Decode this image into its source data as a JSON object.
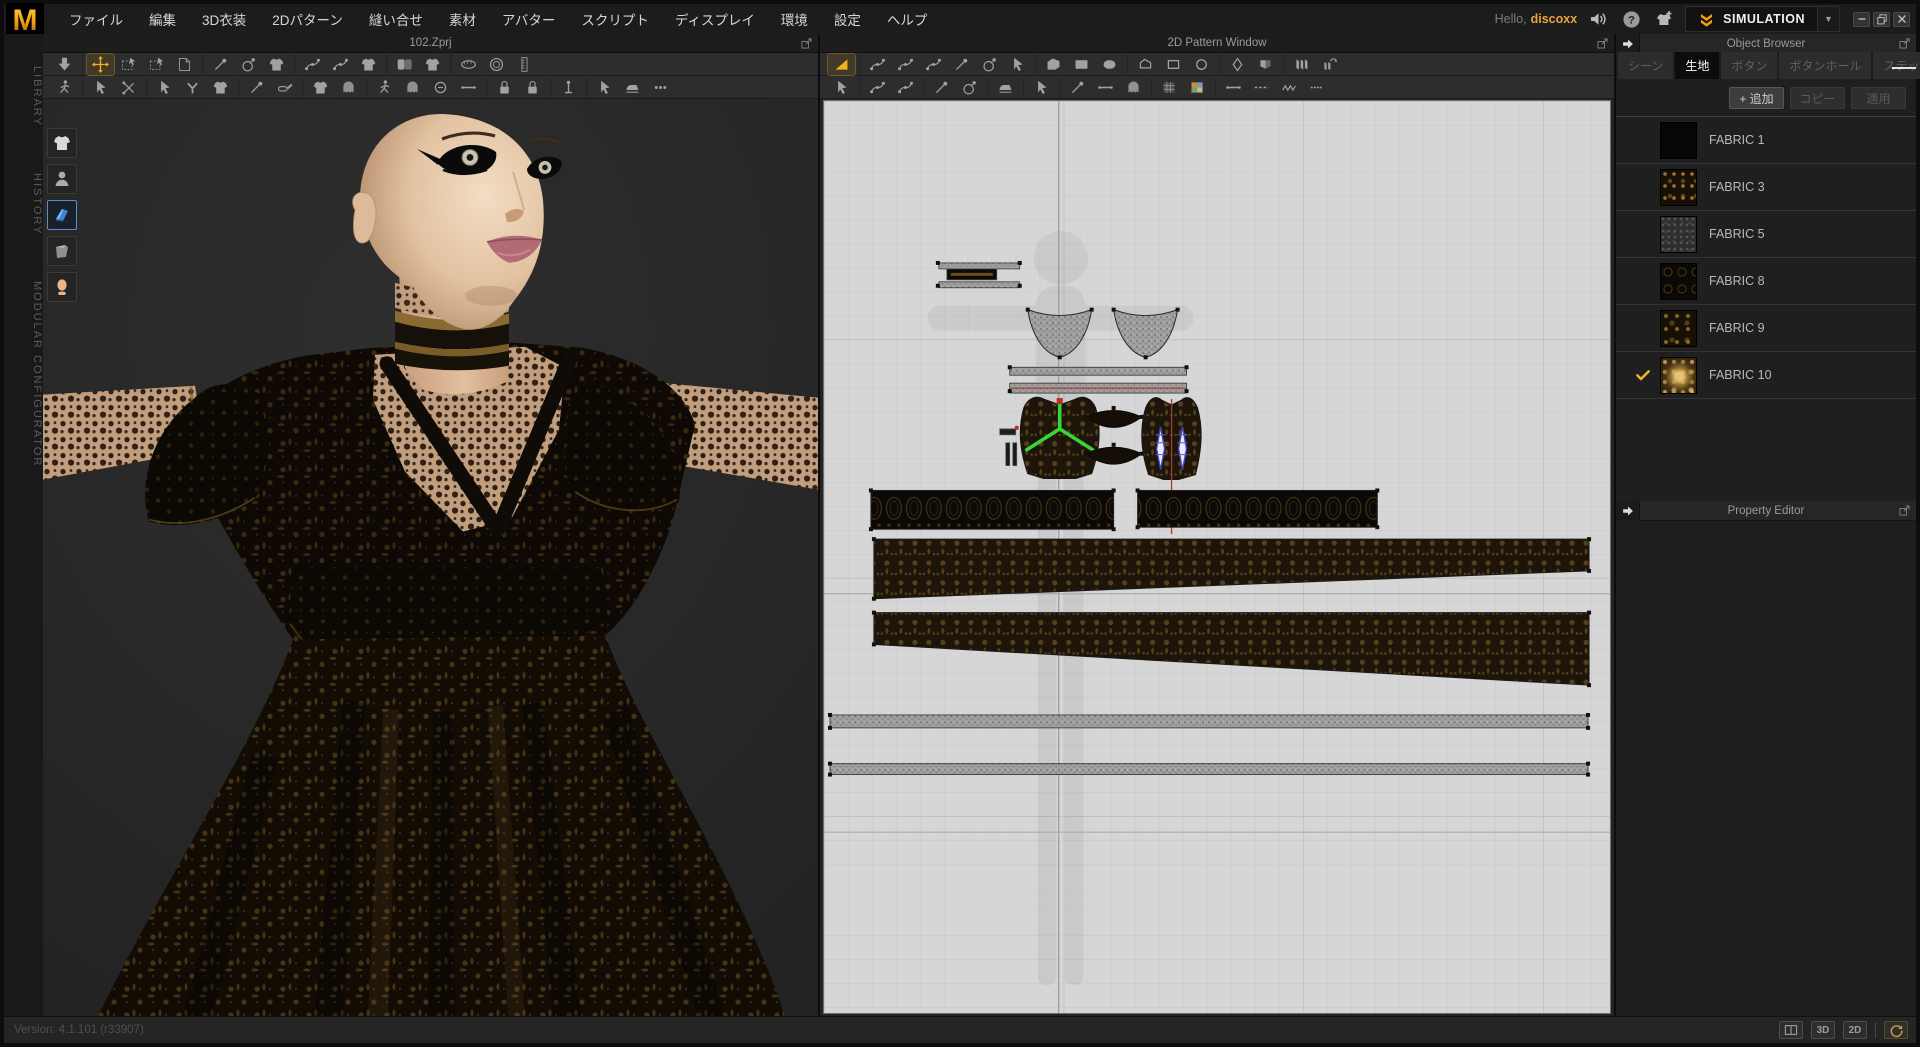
{
  "chrome": {
    "logo": "M",
    "greeting": "Hello,",
    "username": "discoxx",
    "simulation": "SIMULATION",
    "menu": [
      {
        "name": "file",
        "label": "ファイル"
      },
      {
        "name": "edit",
        "label": "編集"
      },
      {
        "name": "3d-garment",
        "label": "3D衣装"
      },
      {
        "name": "2d-pattern",
        "label": "2Dパターン"
      },
      {
        "name": "sewing",
        "label": "縫い合せ"
      },
      {
        "name": "material",
        "label": "素材"
      },
      {
        "name": "avatar",
        "label": "アバター"
      },
      {
        "name": "script",
        "label": "スクリプト"
      },
      {
        "name": "display",
        "label": "ディスプレイ"
      },
      {
        "name": "environment",
        "label": "環境"
      },
      {
        "name": "settings",
        "label": "設定"
      },
      {
        "name": "help",
        "label": "ヘルプ"
      }
    ]
  },
  "left_rail": [
    {
      "name": "library",
      "label": "LIBRARY"
    },
    {
      "name": "history",
      "label": "HISTORY"
    },
    {
      "name": "modular-configurator",
      "label": "MODULAR CONFIGURATOR"
    }
  ],
  "viewport3d": {
    "title": "102.Zprj",
    "tools_row1": [
      [
        {
          "name": "import-drop",
          "icon": "sy-arrowdn"
        }
      ],
      [
        {
          "name": "move",
          "icon": "sy-movex",
          "sel": true
        },
        {
          "name": "rect-select",
          "icon": "sy-dashrect"
        },
        {
          "name": "free-transform",
          "icon": "sy-dashrect"
        },
        {
          "name": "rotate-page",
          "icon": "sy-pagefold"
        }
      ],
      [
        {
          "name": "pin",
          "icon": "sy-pinline"
        },
        {
          "name": "pin-sphere",
          "icon": "sy-spherepin"
        },
        {
          "name": "pin-garment",
          "icon": "sy-shirt"
        }
      ],
      [
        {
          "name": "edit-sewing",
          "icon": "sy-curvepts"
        },
        {
          "name": "free-sewing",
          "icon": "sy-curvepts"
        },
        {
          "name": "sewing-garment",
          "icon": "sy-shirt"
        }
      ],
      [
        {
          "name": "fold-arrangement",
          "icon": "sy-shirts2"
        },
        {
          "name": "arrangement",
          "icon": "sy-shirt"
        }
      ],
      [
        {
          "name": "tape-measure",
          "icon": "sy-tape"
        },
        {
          "name": "circumference-tape",
          "icon": "sy-tapecircle"
        },
        {
          "name": "ruler",
          "icon": "sy-ruler"
        }
      ]
    ],
    "tools_row2": [
      [
        {
          "name": "avatar-move",
          "icon": "sy-walker"
        }
      ],
      [
        {
          "name": "select-mesh",
          "icon": "sy-cursor"
        },
        {
          "name": "scissors",
          "icon": "sy-scissor"
        }
      ],
      [
        {
          "name": "tack-on-avatar",
          "icon": "sy-cursor"
        },
        {
          "name": "y-seam",
          "icon": "sy-ybranch"
        },
        {
          "name": "garment-tack",
          "icon": "sy-shirt"
        }
      ],
      [
        {
          "name": "needle",
          "icon": "sy-pinline"
        },
        {
          "name": "roller",
          "icon": "sy-penroll"
        }
      ],
      [
        {
          "name": "fit-garment",
          "icon": "sy-shirt"
        },
        {
          "name": "avatar-show",
          "icon": "sy-ghost"
        }
      ],
      [
        {
          "name": "measure-avatar",
          "icon": "sy-walker"
        },
        {
          "name": "ghost-mode",
          "icon": "sy-ghost"
        },
        {
          "name": "circle-measure",
          "icon": "sy-circminus"
        },
        {
          "name": "height-measure",
          "icon": "sy-hline"
        }
      ],
      [
        {
          "name": "pin-lock",
          "icon": "sy-lock"
        },
        {
          "name": "lock-all",
          "icon": "sy-lock"
        }
      ],
      [
        {
          "name": "anchor",
          "icon": "sy-anchorpin"
        }
      ],
      [
        {
          "name": "stylus",
          "icon": "sy-cursor"
        },
        {
          "name": "flatten",
          "icon": "sy-iron"
        },
        {
          "name": "more-tools",
          "icon": "sy-dots3"
        }
      ]
    ],
    "side_tools": [
      {
        "name": "show-garment",
        "icon": "garment",
        "sel": false
      },
      {
        "name": "show-avatar",
        "icon": "avatar",
        "sel": false
      },
      {
        "name": "fabric-library",
        "icon": "book",
        "sel": true
      },
      {
        "name": "fabric-roll",
        "icon": "sheet",
        "sel": false
      },
      {
        "name": "avatar-head",
        "icon": "head",
        "sel": false
      }
    ]
  },
  "pattern2d": {
    "title": "2D Pattern Window",
    "tools_row1": [
      [
        {
          "name": "transform-pattern",
          "icon": "sy-tri",
          "sel": true
        }
      ],
      [
        {
          "name": "edit-pattern",
          "icon": "sy-curvepts"
        },
        {
          "name": "edit-curvature",
          "icon": "sy-curvepts"
        },
        {
          "name": "edit-curve-point",
          "icon": "sy-curvepts"
        },
        {
          "name": "add-point",
          "icon": "sy-pinline"
        },
        {
          "name": "insert-point",
          "icon": "sy-spherepin"
        },
        {
          "name": "edit-polygon",
          "icon": "sy-cursor"
        }
      ],
      [
        {
          "name": "polygon",
          "icon": "sy-poly"
        },
        {
          "name": "rectangle",
          "icon": "sy-rectf"
        },
        {
          "name": "ellipse",
          "icon": "sy-ellipsef"
        }
      ],
      [
        {
          "name": "internal-polygon",
          "icon": "sy-polyo"
        },
        {
          "name": "internal-rectangle",
          "icon": "sy-recto"
        },
        {
          "name": "internal-ellipse",
          "icon": "sy-circo"
        }
      ],
      [
        {
          "name": "dart",
          "icon": "sy-diamondo"
        },
        {
          "name": "shape-seam",
          "icon": "sy-shieldh"
        }
      ],
      [
        {
          "name": "pleats",
          "icon": "sy-pleats"
        },
        {
          "name": "fold-pleats",
          "icon": "sy-pleatsarrow"
        }
      ]
    ],
    "tools_row2": [
      [
        {
          "name": "edit-sewing-2d",
          "icon": "sy-cursor"
        }
      ],
      [
        {
          "name": "free-sewing-2d",
          "icon": "sy-curvepts"
        },
        {
          "name": "mn-sewing",
          "icon": "sy-curvepts"
        }
      ],
      [
        {
          "name": "tack-2d",
          "icon": "sy-pinline"
        },
        {
          "name": "pin-2d",
          "icon": "sy-spherepin"
        }
      ],
      [
        {
          "name": "iron-2d",
          "icon": "sy-iron"
        }
      ],
      [
        {
          "name": "grading",
          "icon": "sy-cursor"
        }
      ],
      [
        {
          "name": "annotation",
          "icon": "sy-pinline"
        },
        {
          "name": "baseline",
          "icon": "sy-hline"
        },
        {
          "name": "ghost-avatar-2d",
          "icon": "sy-ghost"
        }
      ],
      [
        {
          "name": "show-grid",
          "icon": "sy-gridsq"
        },
        {
          "name": "texture-view",
          "icon": "sy-colortex"
        }
      ],
      [
        {
          "name": "stitch-solid",
          "icon": "sy-hline"
        },
        {
          "name": "stitch-dash",
          "icon": "sy-linedash"
        },
        {
          "name": "stitch-zigzag",
          "icon": "sy-linezig"
        },
        {
          "name": "stitch-dot",
          "icon": "sy-linedot"
        }
      ]
    ]
  },
  "object_browser": {
    "title": "Object Browser",
    "tabs": [
      {
        "name": "scene",
        "label": "シーン",
        "active": false
      },
      {
        "name": "fabric",
        "label": "生地",
        "active": true
      },
      {
        "name": "button",
        "label": "ボタン",
        "active": false
      },
      {
        "name": "buttonhole",
        "label": "ボタンホール",
        "active": false
      },
      {
        "name": "stitch",
        "label": "ステッチ",
        "active": false
      }
    ],
    "actions": [
      {
        "name": "add",
        "label": "+ 追加",
        "enabled": true
      },
      {
        "name": "copy",
        "label": "コピー",
        "enabled": false
      },
      {
        "name": "apply",
        "label": "適用",
        "enabled": false
      }
    ],
    "fabrics": [
      {
        "name": "FABRIC 1",
        "swatch": "f1",
        "checked": false
      },
      {
        "name": "FABRIC 3",
        "swatch": "f3",
        "checked": false
      },
      {
        "name": "FABRIC 5",
        "swatch": "f5",
        "checked": false
      },
      {
        "name": "FABRIC 8",
        "swatch": "f8",
        "checked": false
      },
      {
        "name": "FABRIC 9",
        "swatch": "f9",
        "checked": false
      },
      {
        "name": "FABRIC 10",
        "swatch": "f10",
        "checked": true
      }
    ]
  },
  "property_editor": {
    "title": "Property Editor"
  },
  "status": {
    "version": "Version: 4.1.101 (r33907)",
    "views": [
      {
        "name": "view-3d",
        "label": "3D"
      },
      {
        "name": "view-2d",
        "label": "2D"
      }
    ]
  },
  "colors": {
    "accent_orange": "#f2a20c",
    "username_orange": "#e8a33d",
    "selection_green": "#3ad43a",
    "guide_red": "#a83832",
    "mark_blue": "#5252cc",
    "canvas_bg": "#d6d6d6"
  }
}
